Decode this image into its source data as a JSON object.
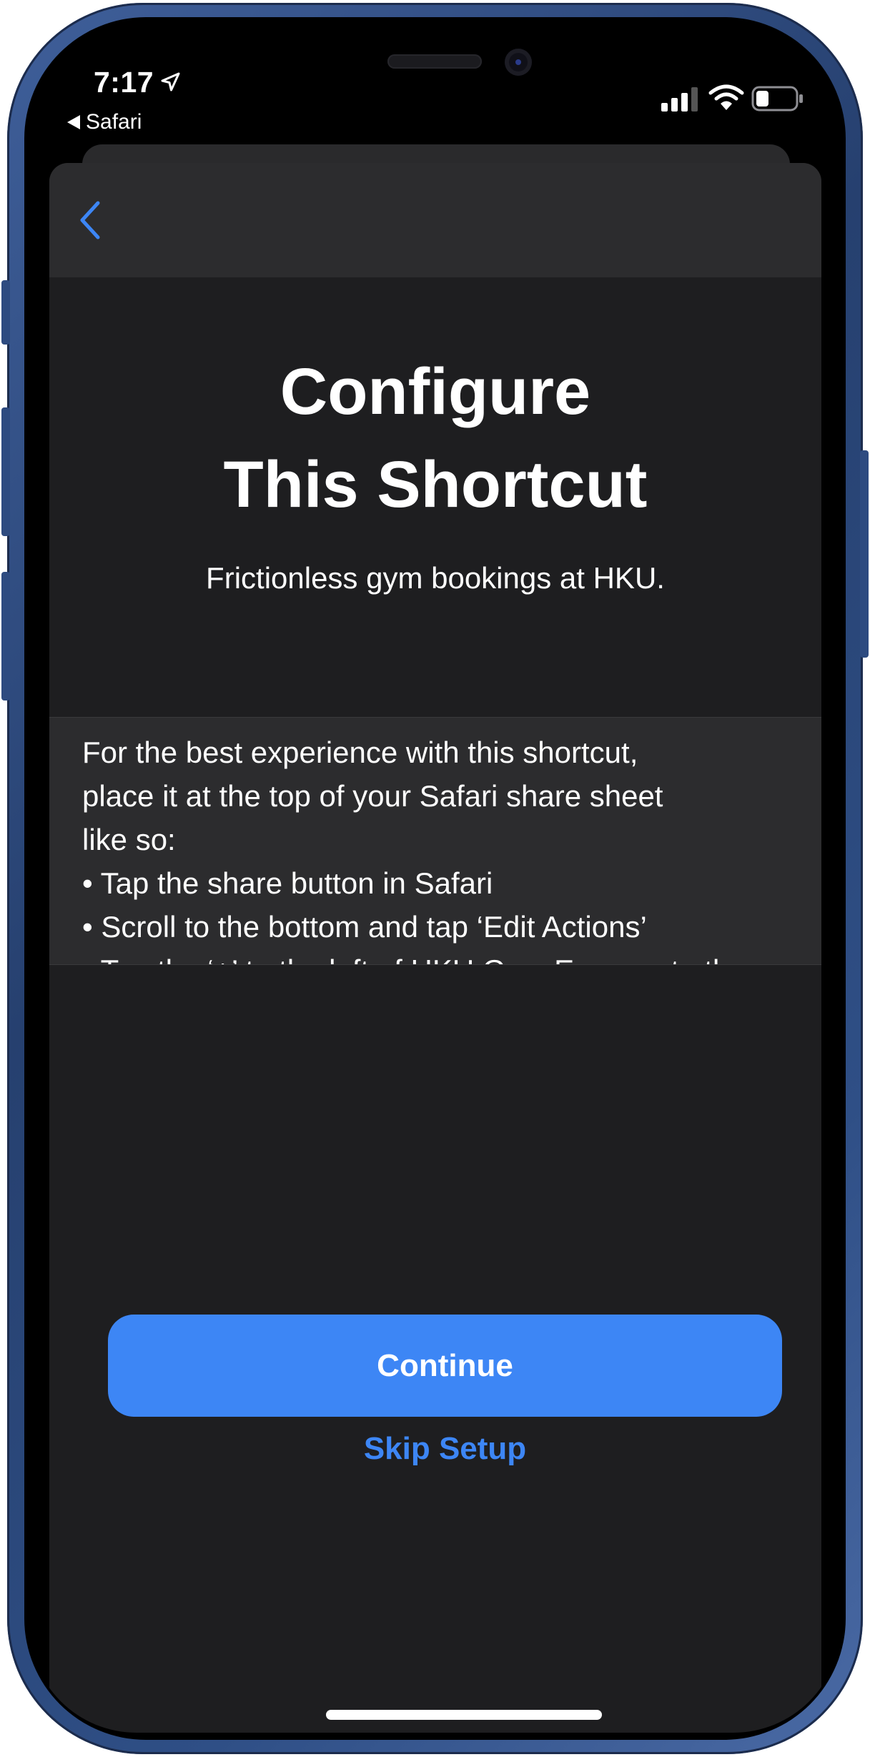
{
  "status_bar": {
    "time": "7:17",
    "back_app_label": "Safari",
    "icons": [
      "location-arrow-icon",
      "cellular-signal-icon",
      "wifi-icon",
      "battery-icon"
    ]
  },
  "nav": {
    "back_icon": "chevron-left-icon"
  },
  "header": {
    "title_line1": "Configure",
    "title_line2": "This Shortcut",
    "subtitle": "Frictionless gym bookings at HKU."
  },
  "description": {
    "intro_line1": "For the best experience with this shortcut,",
    "intro_line2": "place it at the top of your Safari share sheet",
    "intro_line3": "like so:",
    "steps": [
      "• Tap the share button in Safari",
      "• Scroll to the bottom and tap ‘Edit Actions’",
      "• Tap the ‘+’ to the left of HKU Gym Express to the"
    ]
  },
  "actions": {
    "continue_label": "Continue",
    "skip_label": "Skip Setup"
  },
  "colors": {
    "accent": "#3d86f5",
    "sheet_bg": "#1e1e20",
    "nav_bg": "#2c2c2e",
    "frame": "#2f4f86"
  }
}
